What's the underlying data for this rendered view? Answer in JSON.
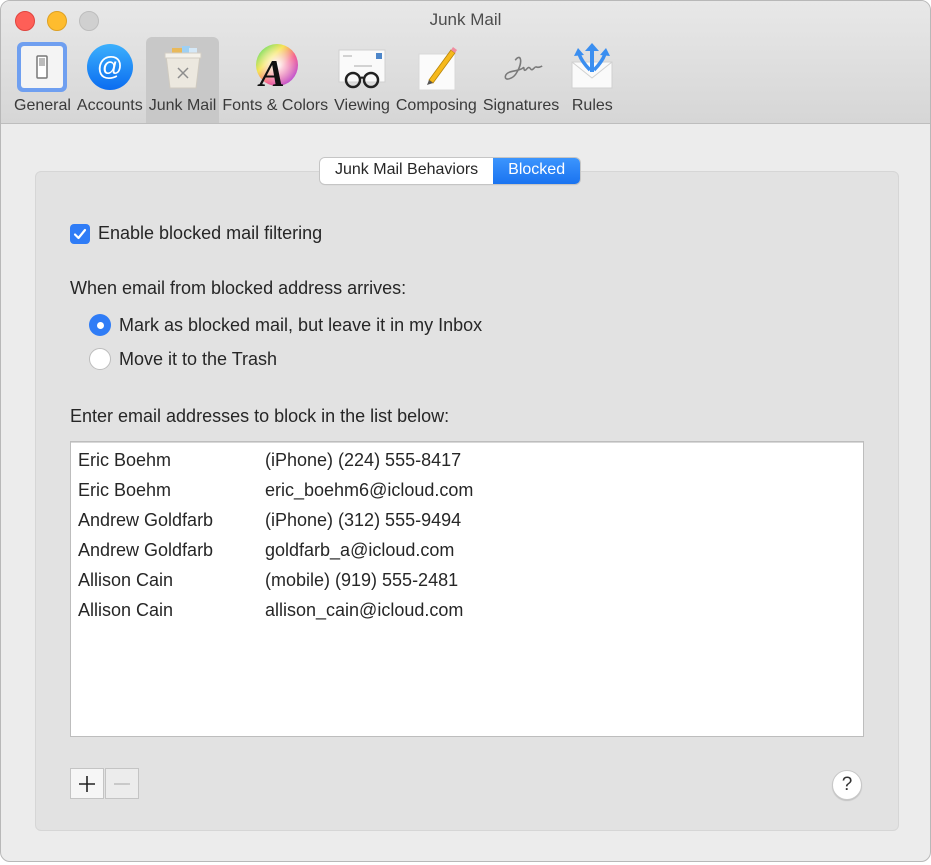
{
  "window": {
    "title": "Junk Mail"
  },
  "toolbar": {
    "items": [
      {
        "label": "General",
        "icon": "general-switch-icon",
        "selected": false
      },
      {
        "label": "Accounts",
        "icon": "at-sign-icon",
        "selected": false
      },
      {
        "label": "Junk Mail",
        "icon": "junk-trash-icon",
        "selected": true
      },
      {
        "label": "Fonts & Colors",
        "icon": "font-color-wheel-icon",
        "selected": false
      },
      {
        "label": "Viewing",
        "icon": "glasses-letter-icon",
        "selected": false
      },
      {
        "label": "Composing",
        "icon": "pencil-paper-icon",
        "selected": false
      },
      {
        "label": "Signatures",
        "icon": "signature-icon",
        "selected": false
      },
      {
        "label": "Rules",
        "icon": "envelope-arrows-icon",
        "selected": false
      }
    ]
  },
  "tabs": {
    "items": [
      {
        "label": "Junk Mail Behaviors",
        "active": false
      },
      {
        "label": "Blocked",
        "active": true
      }
    ]
  },
  "blocked": {
    "enable_label": "Enable blocked mail filtering",
    "enable_checked": true,
    "arrival_label": "When email from blocked address arrives:",
    "options": [
      {
        "label": "Mark as blocked mail, but leave it in my Inbox",
        "selected": true
      },
      {
        "label": "Move it to the Trash",
        "selected": false
      }
    ],
    "list_label": "Enter email addresses to block in the list below:",
    "entries": [
      {
        "name": "Eric Boehm",
        "address": "(iPhone) (224) 555-8417"
      },
      {
        "name": "Eric Boehm",
        "address": "eric_boehm6@icloud.com"
      },
      {
        "name": "Andrew Goldfarb",
        "address": "(iPhone) (312) 555-9494"
      },
      {
        "name": "Andrew Goldfarb",
        "address": "goldfarb_a@icloud.com"
      },
      {
        "name": "Allison Cain",
        "address": "(mobile) (919) 555-2481"
      },
      {
        "name": "Allison Cain",
        "address": "allison_cain@icloud.com"
      }
    ]
  },
  "footer": {
    "add_label": "+",
    "remove_label": "−",
    "help_label": "?"
  },
  "colors": {
    "accent": "#2f7cf6",
    "close": "#fe5f57",
    "minimize": "#febc2e",
    "zoom_disabled": "#d0d0d0"
  }
}
